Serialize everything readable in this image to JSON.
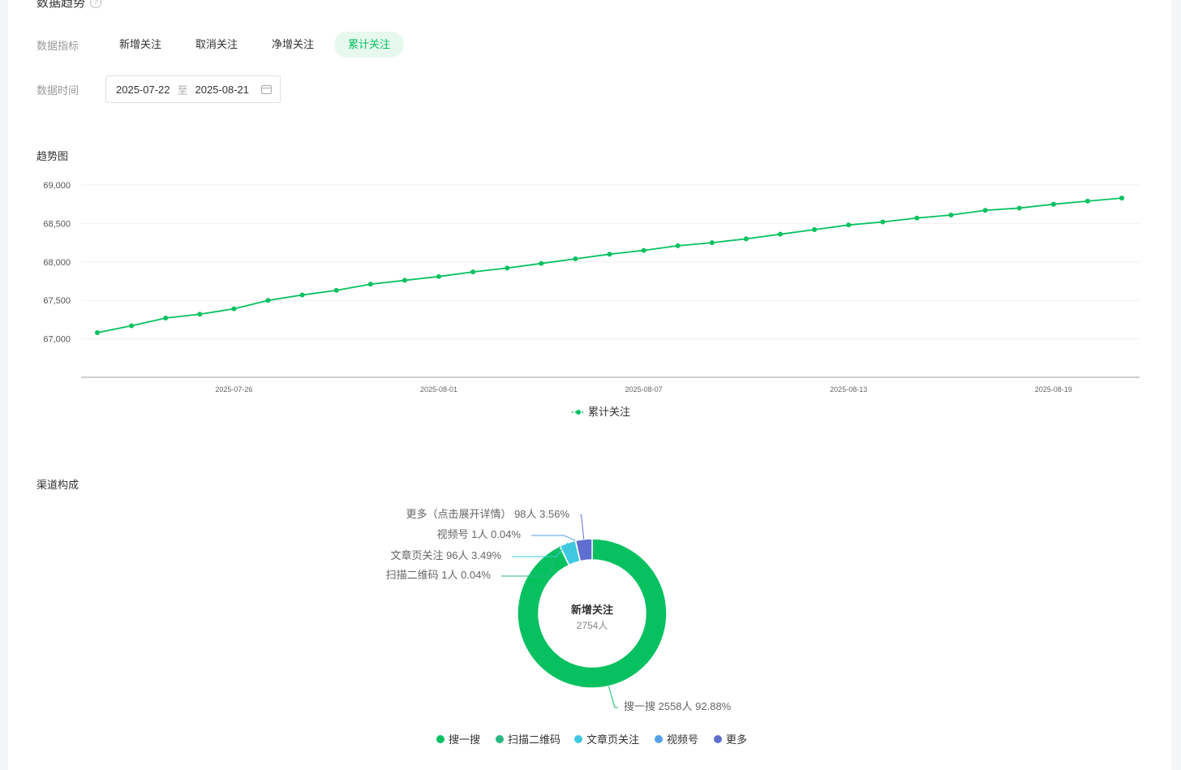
{
  "section": {
    "title": "数据趋势",
    "help": "?"
  },
  "filters": {
    "metric_label": "数据指标",
    "metrics": [
      "新增关注",
      "取消关注",
      "净增关注",
      "累计关注"
    ],
    "active_metric": 3,
    "time_label": "数据时间",
    "start_date": "2025-07-22",
    "range_sep": "至",
    "end_date": "2025-08-21"
  },
  "trend": {
    "title": "趋势图",
    "chart_data": {
      "type": "line",
      "series": [
        {
          "name": "累计关注",
          "color": "#07c160",
          "x": [
            "2025-07-22",
            "2025-07-23",
            "2025-07-24",
            "2025-07-25",
            "2025-07-26",
            "2025-07-27",
            "2025-07-28",
            "2025-07-29",
            "2025-07-30",
            "2025-07-31",
            "2025-08-01",
            "2025-08-02",
            "2025-08-03",
            "2025-08-04",
            "2025-08-05",
            "2025-08-06",
            "2025-08-07",
            "2025-08-08",
            "2025-08-09",
            "2025-08-10",
            "2025-08-11",
            "2025-08-12",
            "2025-08-13",
            "2025-08-14",
            "2025-08-15",
            "2025-08-16",
            "2025-08-17",
            "2025-08-18",
            "2025-08-19",
            "2025-08-20",
            "2025-08-21"
          ],
          "values": [
            67080,
            67170,
            67270,
            67320,
            67390,
            67500,
            67570,
            67630,
            67710,
            67760,
            67810,
            67870,
            67920,
            67980,
            68040,
            68100,
            68150,
            68210,
            68250,
            68300,
            68360,
            68420,
            68480,
            68520,
            68570,
            68610,
            68670,
            68700,
            68750,
            68790,
            68830
          ]
        }
      ],
      "y_ticks": [
        "67,000",
        "67,500",
        "68,000",
        "68,500",
        "69,000"
      ],
      "y_tick_values": [
        67000,
        67500,
        68000,
        68500,
        69000
      ],
      "ylim": [
        66500,
        69000
      ],
      "x_tick_labels": [
        "2025-07-26",
        "2025-08-01",
        "2025-08-07",
        "2025-08-13",
        "2025-08-19"
      ],
      "grid": true,
      "legend": "bottom"
    }
  },
  "channel": {
    "title": "渠道构成",
    "center_title": "新增关注",
    "center_value": "2754人",
    "chart_data": {
      "type": "pie",
      "total": 2754,
      "slices": [
        {
          "name": "搜一搜",
          "count": 2558,
          "percent": 92.88,
          "color": "#07c160",
          "label": "搜一搜 2558人 92.88%"
        },
        {
          "name": "扫描二维码",
          "count": 1,
          "percent": 0.04,
          "color": "#2bb784",
          "label": "扫描二维码 1人 0.04%"
        },
        {
          "name": "文章页关注",
          "count": 96,
          "percent": 3.49,
          "color": "#3fc8e0",
          "label": "文章页关注 96人 3.49%"
        },
        {
          "name": "视频号",
          "count": 1,
          "percent": 0.04,
          "color": "#55a2e8",
          "label": "视频号 1人 0.04%"
        },
        {
          "name": "更多",
          "count": 98,
          "percent": 3.56,
          "color": "#5e6fcf",
          "label": "更多（点击展开详情） 98人 3.56%"
        }
      ],
      "legend": "bottom"
    }
  }
}
